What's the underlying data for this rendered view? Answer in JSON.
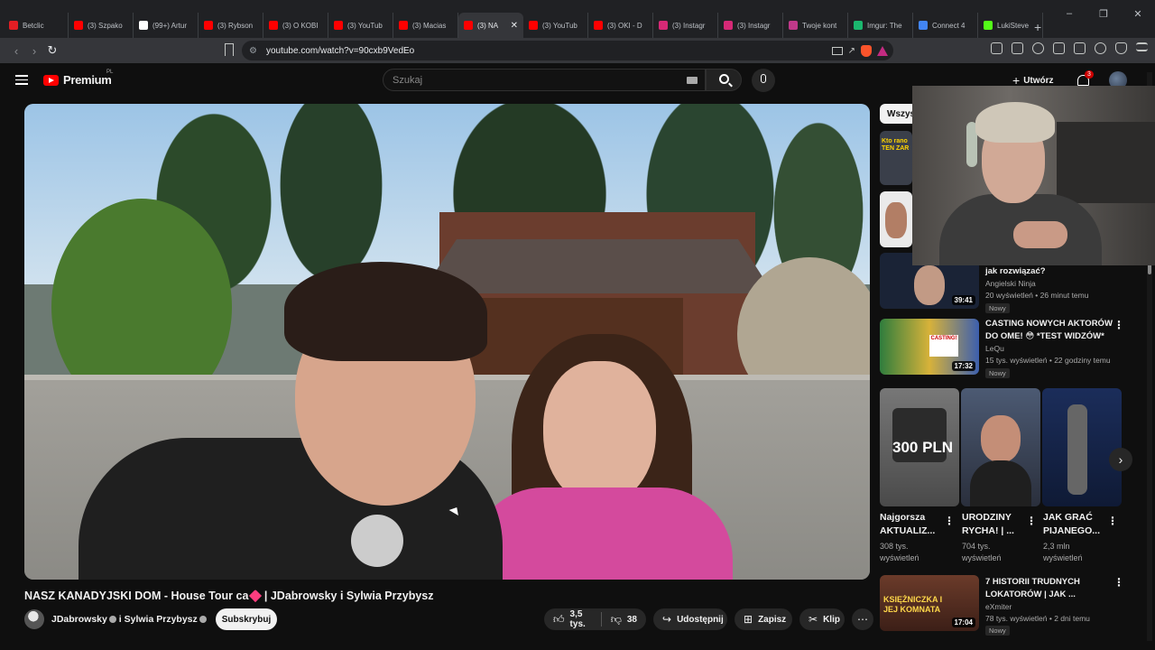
{
  "browser": {
    "tabs": [
      {
        "label": "Betclic",
        "color": "#e31e24"
      },
      {
        "label": "(3) Szpako",
        "color": "#ff0000"
      },
      {
        "label": "(99+) Artur",
        "color": "#ffffff"
      },
      {
        "label": "(3) Rybson",
        "color": "#ff0000"
      },
      {
        "label": "(3) O KOBI",
        "color": "#ff0000"
      },
      {
        "label": "(3) YouTub",
        "color": "#ff0000"
      },
      {
        "label": "(3) Macias",
        "color": "#ff0000"
      },
      {
        "label": "(3) NA",
        "color": "#ff0000",
        "active": true
      },
      {
        "label": "(3) YouTub",
        "color": "#ff0000"
      },
      {
        "label": "(3) OKI - D",
        "color": "#ff0000"
      },
      {
        "label": "(3) Instagr",
        "color": "#d62976"
      },
      {
        "label": "(3) Instagr",
        "color": "#d62976"
      },
      {
        "label": "Twoje kont",
        "color": "#c0398a"
      },
      {
        "label": "Imgur: The",
        "color": "#1bb76e"
      },
      {
        "label": "Connect 4",
        "color": "#4285f4"
      },
      {
        "label": "LukiSteve",
        "color": "#53fc18"
      }
    ],
    "new_tab_glyph": "+",
    "url": "youtube.com/watch?v=90cxb9VedEo",
    "minimize_glyph": "–",
    "restore_glyph": "❐",
    "close_glyph": "✕"
  },
  "youtube": {
    "logo_text": "Premium",
    "logo_region": "PL",
    "search_placeholder": "Szukaj",
    "create_label": "Utwórz",
    "notif_count": "3"
  },
  "video": {
    "title_before": "NASZ KANADYJSKI DOM - House Tour ca",
    "title_after": " | JDabrowsky i Sylwia Przybysz",
    "channel": "JDabrowsky",
    "channel_join": "i Sylwia Przybysz",
    "subscribe_label": "Subskrybuj",
    "likes": "3,5 tys.",
    "dislikes": "38",
    "share_label": "Udostępnij",
    "save_label": "Zapisz",
    "clip_label": "Klip"
  },
  "sidebar": {
    "chip_label": "Wszys",
    "thumb1_text": "Kto rano TEN ZAR",
    "items": [
      {
        "title": "jak rozwiązać?",
        "channel": "Angielski Ninja",
        "meta": "20 wyświetleń • 26 minut temu",
        "badge": "Nowy",
        "duration": "39:41"
      },
      {
        "title_line1": "CASTING NOWYCH AKTORÓW",
        "title_line2": "DO OME! 😳 *TEST WIDZÓW*",
        "channel": "LeQu",
        "meta": "15 tys. wyświetleń • 22 godziny temu",
        "badge": "Nowy",
        "duration": "17:32"
      },
      {
        "title_line1": "7 HISTORII TRUDNYCH",
        "title_line2": "LOKATORÓW | JAK ...",
        "channel": "eXmiter",
        "meta": "78 tys. wyświetleń • 2 dni temu",
        "badge": "Nowy",
        "duration": "17:04"
      }
    ],
    "shorts": [
      {
        "title_line1": "Najgorsza",
        "title_line2": "AKTUALIZ...",
        "views_line1": "308 tys.",
        "views_line2": "wyświetleń",
        "overlay": "300 PLN"
      },
      {
        "title_line1": "URODZINY",
        "title_line2": "RYCHA! | ...",
        "views_line1": "704 tys.",
        "views_line2": "wyświetleń"
      },
      {
        "title_line1": "JAK GRAĆ",
        "title_line2": "PIJANEGO...",
        "views_line1": "2,3 mln",
        "views_line2": "wyświetleń"
      }
    ],
    "thumb3_text": "KSIĘŻNICZKA I JEJ KOMNATA"
  }
}
